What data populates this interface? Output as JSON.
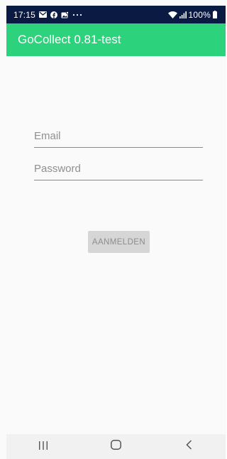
{
  "status_bar": {
    "time": "17:15",
    "battery_percent": "100%",
    "icons": [
      "mail-icon",
      "facebook-icon",
      "photo-icon",
      "more-icon",
      "wifi-icon",
      "signal-icon",
      "battery-icon"
    ]
  },
  "app_bar": {
    "title": "GoCollect 0.81-test",
    "color": "#2dd27c"
  },
  "login_form": {
    "email_placeholder": "Email",
    "email_value": "",
    "password_placeholder": "Password",
    "password_value": "",
    "submit_label": "AANMELDEN"
  },
  "nav_bar": {
    "icons": [
      "recent-apps-icon",
      "home-icon",
      "back-icon"
    ]
  }
}
